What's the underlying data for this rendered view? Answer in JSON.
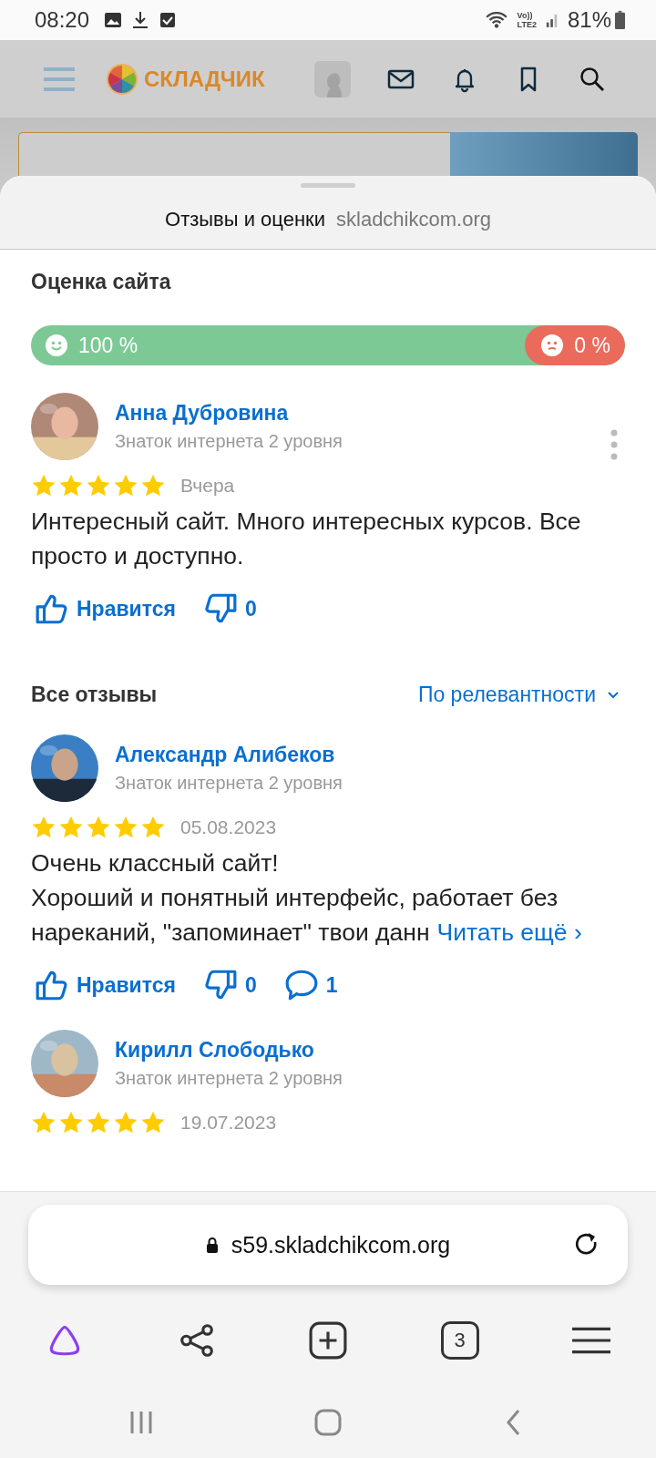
{
  "status_bar": {
    "time": "08:20",
    "network_top": "Vo))",
    "network_bottom": "LTE2",
    "battery": "81%"
  },
  "site_header": {
    "logo": "СКЛАДЧИК"
  },
  "sheet": {
    "title": "Отзывы и оценки",
    "domain": "skladchikcom.org"
  },
  "rating": {
    "heading": "Оценка сайта",
    "positive": "100 %",
    "negative": "0 %"
  },
  "featured_review": {
    "author": "Анна Дубровина",
    "level": "Знаток интернета 2 уровня",
    "stars": 5,
    "date": "Вчера",
    "text": "Интересный сайт. Много интересных курсов. Все просто и доступно.",
    "like": "Нравится",
    "dislikes": "0",
    "menu": true
  },
  "all_reviews": {
    "heading": "Все отзывы",
    "sort": "По релевантности",
    "reviews": [
      {
        "author": "Александр Алибеков",
        "level": "Знаток интернета 2 уровня",
        "stars": 5,
        "date": "05.08.2023",
        "text": "Очень классный сайт!\nХороший и понятный интерфейс, работает без нареканий, \"запоминает\" твои данн",
        "more": "Читать ещё ›",
        "like": "Нравится",
        "dislikes": "0",
        "comments": "1"
      },
      {
        "author": "Кирилл Слободько",
        "level": "Знаток интернета 2 уровня",
        "stars": 5,
        "date": "19.07.2023"
      }
    ]
  },
  "address_bar": {
    "url": "s59.skladchikcom.org"
  },
  "toolbar": {
    "tabs_count": "3"
  }
}
